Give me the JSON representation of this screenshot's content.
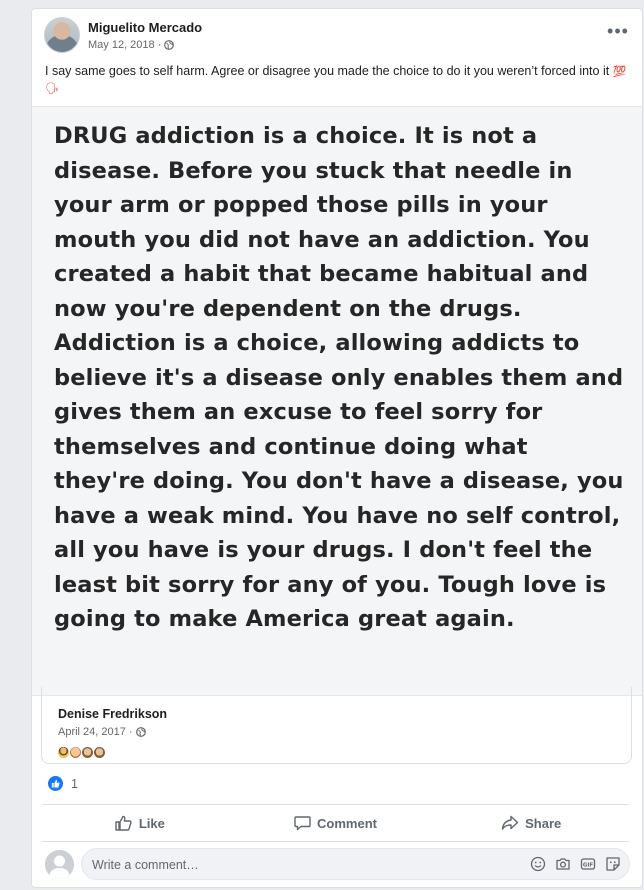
{
  "post": {
    "author": "Miguelito Mercado",
    "date": "May 12, 2018 ·",
    "caption": "I say same goes to self harm. Agree or disagree you made the choice to do it you weren’t forced into it",
    "caption_emojis": "💯🗣",
    "more_label": "•••"
  },
  "image": {
    "text": "DRUG addiction is a choice. It is not a disease. Before you stuck that needle in your arm or popped those pills in your mouth you did not have an addiction. You created a habit that became habitual and now you're dependent on the drugs. Addiction is a choice, allowing addicts to believe it's a disease only enables them and gives them an excuse to feel sorry for themselves and continue doing what they're doing. You don't have a disease, you have a weak mind. You have no self control, all you have is your drugs. I don't feel the least bit sorry for any of you. Tough love is going to make America great again."
  },
  "shared": {
    "author": "Denise Fredrikson",
    "date": "April 24, 2017 ·",
    "emojis": [
      "person-emoji",
      "face-emoji",
      "see-no-evil-monkey",
      "see-no-evil-monkey"
    ]
  },
  "reactions": {
    "count": "1",
    "type": "like"
  },
  "actions": {
    "like": "Like",
    "comment": "Comment",
    "share": "Share"
  },
  "comment_box": {
    "placeholder": "Write a comment…"
  },
  "colors": {
    "accent": "#1877f2",
    "muted": "#65676b"
  }
}
